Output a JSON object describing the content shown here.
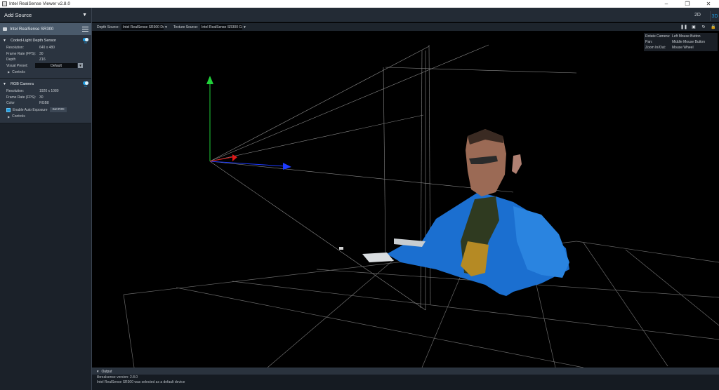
{
  "window": {
    "title": "Intel RealSense Viewer v2.8.0",
    "minimize": "–",
    "maximize": "❐",
    "close": "✕"
  },
  "sidebar": {
    "add_source": "Add Source",
    "add_source_caret": "▼",
    "device_name": "Intel RealSense SR300",
    "sensors": [
      {
        "name": "Coded-Light Depth Sensor",
        "toggle_state": "on",
        "props": [
          {
            "key": "Resolution:",
            "value": "640 x 480"
          },
          {
            "key": "Frame Rate (FPS):",
            "value": "30"
          },
          {
            "key": "Depth",
            "value": "Z16"
          }
        ],
        "visual_preset_label": "Visual Preset:",
        "visual_preset_value": "Default",
        "controls_label": "Controls"
      },
      {
        "name": "RGB Camera",
        "toggle_state": "on",
        "props": [
          {
            "key": "Resolution:",
            "value": "1920 x 1080"
          },
          {
            "key": "Frame Rate (FPS):",
            "value": "30"
          },
          {
            "key": "Color",
            "value": "RGB8"
          }
        ],
        "auto_exposure_label": "Enable Auto Exposure",
        "set_roi_label": "Set ROI",
        "controls_label": "Controls"
      }
    ]
  },
  "toolbar": {
    "view_2d": "2D",
    "view_3d": "3D",
    "depth_source_label": "Depth Source:",
    "depth_source_value": "Intel RealSense SR300 De",
    "texture_source_label": "Texture Source:",
    "texture_source_value": "Intel RealSense SR300 Col",
    "dropdown_caret": "▼",
    "tools": [
      "❚❚",
      "▣",
      "↻",
      "🔒"
    ]
  },
  "viewport_help": [
    {
      "action": "Rotate Camera:",
      "control": "Left Mouse Button"
    },
    {
      "action": "Pan:",
      "control": "Middle Mouse Button"
    },
    {
      "action": "Zoom In/Out:",
      "control": "Mouse Wheel"
    }
  ],
  "output": {
    "title": "Output",
    "lines": [
      "librealsense version: 2.8.0",
      "Intel RealSense SR300 was selected as a default device"
    ]
  },
  "colors": {
    "accent": "#1e9be0",
    "axis_x": "#1d3bff",
    "axis_y": "#21d13a",
    "axis_z": "#e01818",
    "jacket": "#1b6fd0"
  },
  "icons": {
    "triangle_down": "▼",
    "triangle_right": "▶"
  }
}
